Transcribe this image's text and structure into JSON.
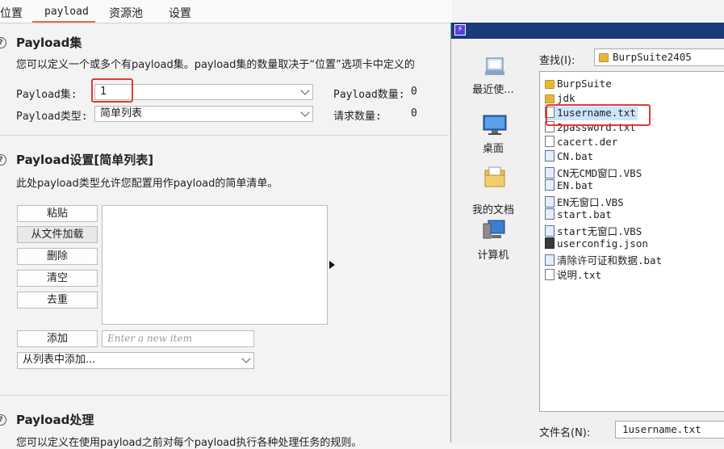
{
  "tabs": [
    {
      "label": "位置"
    },
    {
      "label": "payload"
    },
    {
      "label": "资源池"
    },
    {
      "label": "设置"
    }
  ],
  "payload_sets": {
    "title": "Payload集",
    "description": "您可以定义一个或多个有payload集。payload集的数量取决于“位置”选项卡中定义的",
    "set_label": "Payload集:",
    "set_value": "1",
    "type_label": "Payload类型:",
    "type_value": "简单列表",
    "count_label": "Payload数量:",
    "count_value": "0",
    "request_label": "请求数量:",
    "request_value": "0"
  },
  "payload_settings": {
    "title": "Payload设置[简单列表]",
    "description": "此处payload类型允许您配置用作payload的简单清单。",
    "buttons": {
      "paste": "粘贴",
      "load": "从文件加载",
      "remove": "删除",
      "clear": "清空",
      "dedupe": "去重",
      "add": "添加"
    },
    "add_placeholder": "Enter a new item",
    "add_from_list": "从列表中添加..."
  },
  "payload_processing": {
    "title": "Payload处理",
    "description": "您可以定义在使用payload之前对每个payload执行各种处理任务的规则。"
  },
  "dialog": {
    "look_in_label": "查找(I):",
    "look_in_value": "BurpSuite2405",
    "places": [
      {
        "label": "最近使...",
        "icon": "recent-icon"
      },
      {
        "label": "桌面",
        "icon": "desktop-icon"
      },
      {
        "label": "我的文档",
        "icon": "documents-icon"
      },
      {
        "label": "计算机",
        "icon": "computer-icon"
      }
    ],
    "files": [
      {
        "name": "BurpSuite",
        "icon": "folder"
      },
      {
        "name": "jdk",
        "icon": "folder"
      },
      {
        "name": "1username.txt",
        "icon": "doc"
      },
      {
        "name": "2password.txt",
        "icon": "doc"
      },
      {
        "name": "cacert.der",
        "icon": "doc"
      },
      {
        "name": "CN.bat",
        "icon": "bat"
      },
      {
        "name": "CN无CMD窗口.VBS",
        "icon": "bat"
      },
      {
        "name": "EN.bat",
        "icon": "bat"
      },
      {
        "name": "EN无窗口.VBS",
        "icon": "bat"
      },
      {
        "name": "start.bat",
        "icon": "bat"
      },
      {
        "name": "start无窗口.VBS",
        "icon": "bat"
      },
      {
        "name": "userconfig.json",
        "icon": "json"
      },
      {
        "name": "清除许可证和数据.bat",
        "icon": "bat"
      },
      {
        "name": "说明.txt",
        "icon": "doc"
      }
    ],
    "selected_file": "1username.txt",
    "filename_label": "文件名(N):",
    "filename_value": "1username.txt"
  },
  "colors": {
    "accent_tab": "#e8703a",
    "highlight_box": "#e53935",
    "titlebar": "#1a3a7a"
  }
}
